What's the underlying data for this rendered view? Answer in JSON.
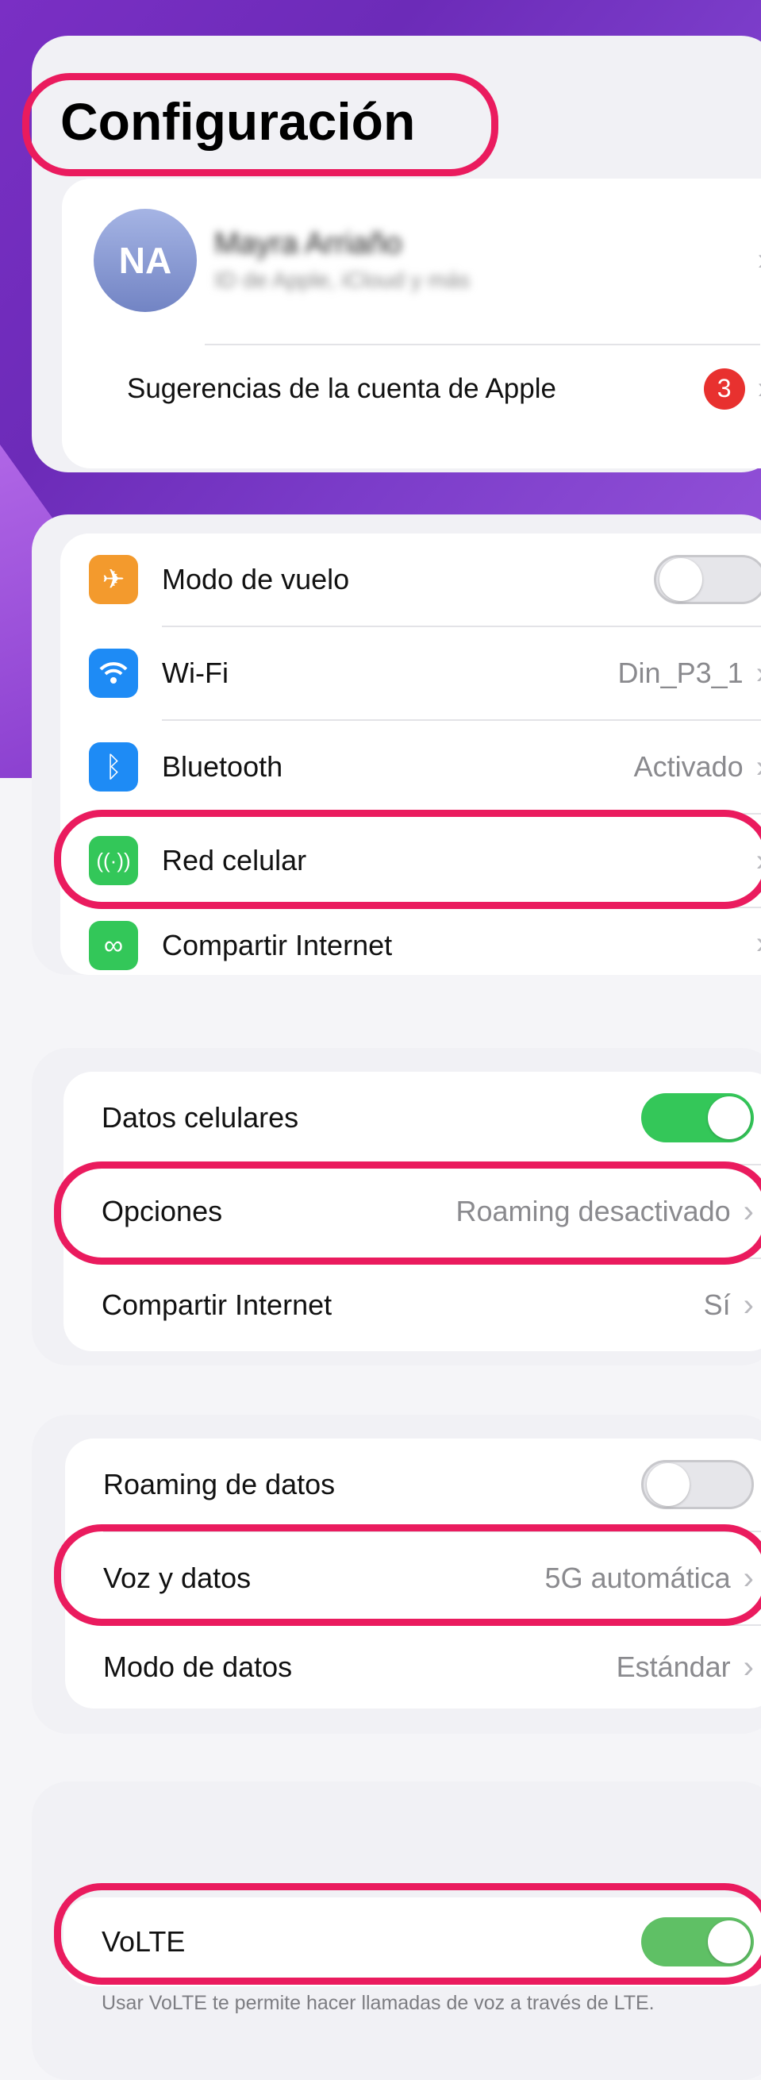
{
  "header": {
    "title": "Configuración"
  },
  "account": {
    "avatar_initials": "NA",
    "name": "Mayra Arriaño",
    "subtitle": "ID de Apple, iCloud y más",
    "suggestions_label": "Sugerencias de la cuenta de Apple",
    "suggestions_badge": "3"
  },
  "settings": {
    "airplane": {
      "label": "Modo de vuelo",
      "on": false,
      "icon": "airplane-icon"
    },
    "wifi": {
      "label": "Wi-Fi",
      "value": "Din_P3_1",
      "icon": "wifi-icon"
    },
    "bluetooth": {
      "label": "Bluetooth",
      "value": "Activado",
      "icon": "bluetooth-icon"
    },
    "cellular": {
      "label": "Red celular",
      "icon": "antenna-icon"
    },
    "hotspot": {
      "label": "Compartir Internet",
      "icon": "link-icon"
    }
  },
  "cellular": {
    "data": {
      "label": "Datos celulares",
      "on": true
    },
    "options": {
      "label": "Opciones",
      "value": "Roaming desactivado"
    },
    "hotspot": {
      "label": "Compartir Internet",
      "value": "Sí"
    }
  },
  "options": {
    "roaming": {
      "label": "Roaming de datos",
      "on": false
    },
    "voice": {
      "label": "Voz y datos",
      "value": "5G automática"
    },
    "data_mode": {
      "label": "Modo de datos",
      "value": "Estándar"
    }
  },
  "volte": {
    "label": "VoLTE",
    "on": true,
    "footnote": "Usar VoLTE te permite hacer llamadas de voz a través de LTE."
  },
  "colors": {
    "highlight": "#ea1b5e",
    "toggle_on": "#34c759",
    "wifi": "#1e8bf5",
    "airplane": "#f39a2d",
    "green": "#33c759",
    "badge": "#e8312f"
  }
}
